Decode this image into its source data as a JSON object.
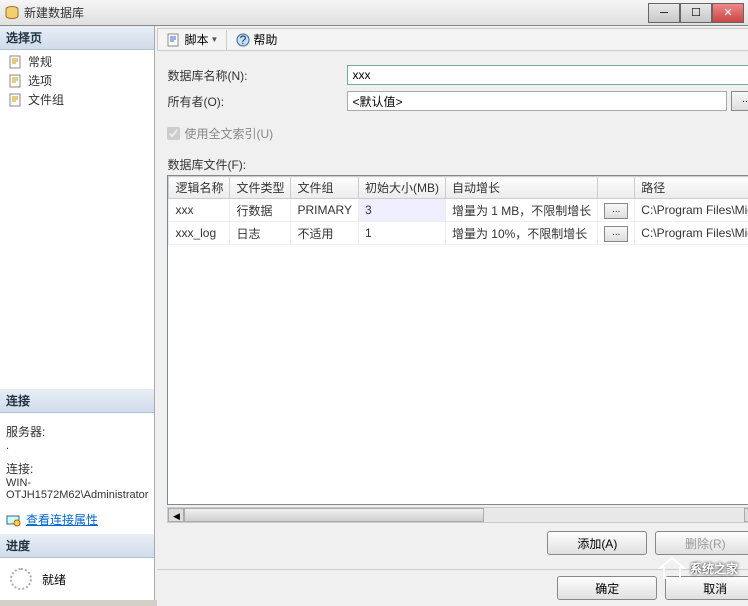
{
  "window": {
    "title": "新建数据库"
  },
  "sidebar": {
    "select_page_header": "选择页",
    "items": [
      {
        "label": "常规"
      },
      {
        "label": "选项"
      },
      {
        "label": "文件组"
      }
    ],
    "connection_header": "连接",
    "server_label": "服务器:",
    "server_value": ".",
    "conn_label": "连接:",
    "conn_value": "WIN-OTJH1572M62\\Administrator",
    "view_conn_props": "查看连接属性",
    "progress_header": "进度",
    "progress_status": "就绪"
  },
  "toolbar": {
    "script_label": "脚本",
    "help_label": "帮助"
  },
  "form": {
    "db_name_label": "数据库名称(N):",
    "db_name_value": "xxx",
    "owner_label": "所有者(O):",
    "owner_value": "<默认值>",
    "fulltext_label": "使用全文索引(U)",
    "files_label": "数据库文件(F):"
  },
  "grid": {
    "headers": {
      "logical_name": "逻辑名称",
      "file_type": "文件类型",
      "file_group": "文件组",
      "initial_size": "初始大小(MB)",
      "autogrowth": "自动增长",
      "path": "路径"
    },
    "rows": [
      {
        "name": "xxx",
        "type": "行数据",
        "group": "PRIMARY",
        "size": "3",
        "growth": "增量为 1 MB，不限制增长",
        "path": "C:\\Program Files\\Mic"
      },
      {
        "name": "xxx_log",
        "type": "日志",
        "group": "不适用",
        "size": "1",
        "growth": "增量为 10%，不限制增长",
        "path": "C:\\Program Files\\Mic"
      }
    ]
  },
  "buttons": {
    "add": "添加(A)",
    "remove": "删除(R)",
    "ok": "确定",
    "cancel": "取消"
  },
  "watermark": "系统之家"
}
